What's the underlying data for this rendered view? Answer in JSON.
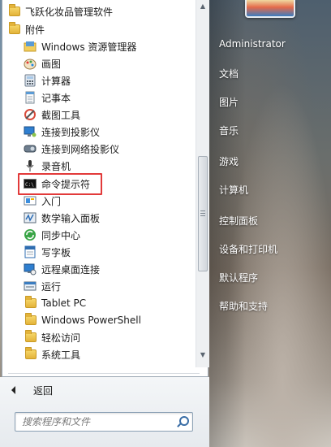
{
  "programs": [
    {
      "label": "飞跃化妆品管理软件",
      "icon": "folder-icon"
    },
    {
      "label": "附件",
      "icon": "folder-icon"
    },
    {
      "label": "Windows 资源管理器",
      "icon": "explorer-icon"
    },
    {
      "label": "画图",
      "icon": "paint-icon"
    },
    {
      "label": "计算器",
      "icon": "calculator-icon"
    },
    {
      "label": "记事本",
      "icon": "notepad-icon"
    },
    {
      "label": "截图工具",
      "icon": "snipping-tool-icon"
    },
    {
      "label": "连接到投影仪",
      "icon": "projector-icon"
    },
    {
      "label": "连接到网络投影仪",
      "icon": "network-projector-icon"
    },
    {
      "label": "录音机",
      "icon": "microphone-icon"
    },
    {
      "label": "命令提示符",
      "icon": "command-prompt-icon"
    },
    {
      "label": "入门",
      "icon": "getting-started-icon"
    },
    {
      "label": "数学输入面板",
      "icon": "math-input-icon"
    },
    {
      "label": "同步中心",
      "icon": "sync-center-icon"
    },
    {
      "label": "写字板",
      "icon": "wordpad-icon"
    },
    {
      "label": "远程桌面连接",
      "icon": "remote-desktop-icon"
    },
    {
      "label": "运行",
      "icon": "run-icon"
    },
    {
      "label": "Tablet PC",
      "icon": "folder-icon"
    },
    {
      "label": "Windows PowerShell",
      "icon": "folder-icon"
    },
    {
      "label": "轻松访问",
      "icon": "folder-icon"
    },
    {
      "label": "系统工具",
      "icon": "folder-icon"
    }
  ],
  "back_label": "返回",
  "search": {
    "placeholder": "搜索程序和文件"
  },
  "right_menu": [
    "Administrator",
    "文档",
    "图片",
    "音乐",
    "游戏",
    "计算机",
    "控制面板",
    "设备和打印机",
    "默认程序",
    "帮助和支持"
  ],
  "colors": {
    "highlight_border": "#e23a3a",
    "menu_text_right": "#ffffff",
    "search_icon": "#3b6ea6"
  }
}
